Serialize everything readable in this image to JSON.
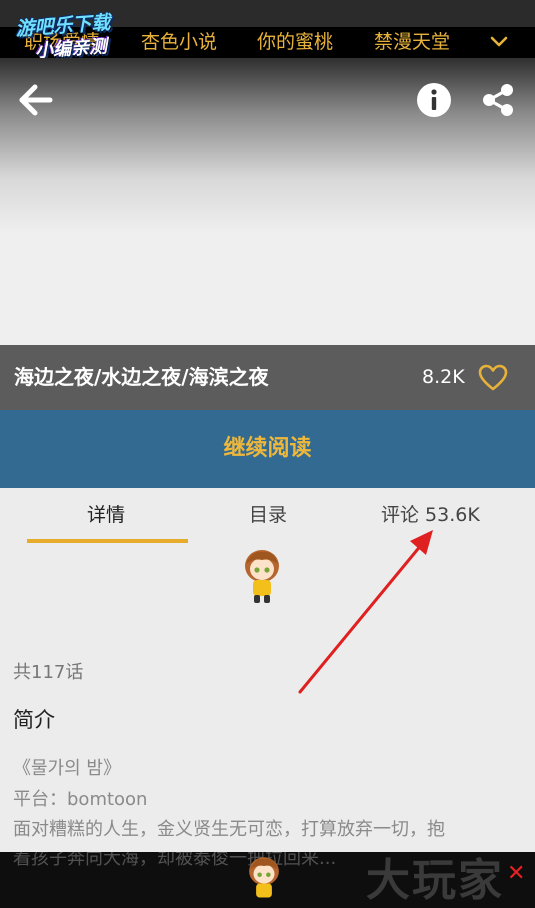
{
  "watermark": {
    "line1": "游吧乐下载",
    "line2": "小编亲测"
  },
  "top_tabs": [
    "职场爱情",
    "杏色小说",
    "你的蜜桃",
    "禁漫天堂"
  ],
  "top_tabs_more_icon": "chevron-down-icon",
  "header_icons": [
    "arrow-left-icon",
    "info-icon",
    "share-icon"
  ],
  "comic": {
    "title": "海边之夜/水边之夜/海滨之夜",
    "likes": "8.2K"
  },
  "continue_label": "继续阅读",
  "tabs": [
    {
      "label": "详情",
      "active": true
    },
    {
      "label": "目录",
      "active": false
    },
    {
      "label": "评论 53.6K",
      "active": false
    }
  ],
  "episode_count": "共117话",
  "intro_heading": "简介",
  "intro_lines": [
    "《물가의 밤》",
    "平台：bomtoon",
    "面对糟糕的人生，金义贤生无可恋，打算放弃一切，抱",
    "着孩子奔向大海，却被泰俊一把拉回来..."
  ],
  "brand": "大玩家",
  "brand_mark": "✕",
  "colors": {
    "accent": "#e8b23a",
    "continue_bg": "#336a91",
    "title_bg": "#5c5c5c",
    "annotation": "#e02020"
  }
}
